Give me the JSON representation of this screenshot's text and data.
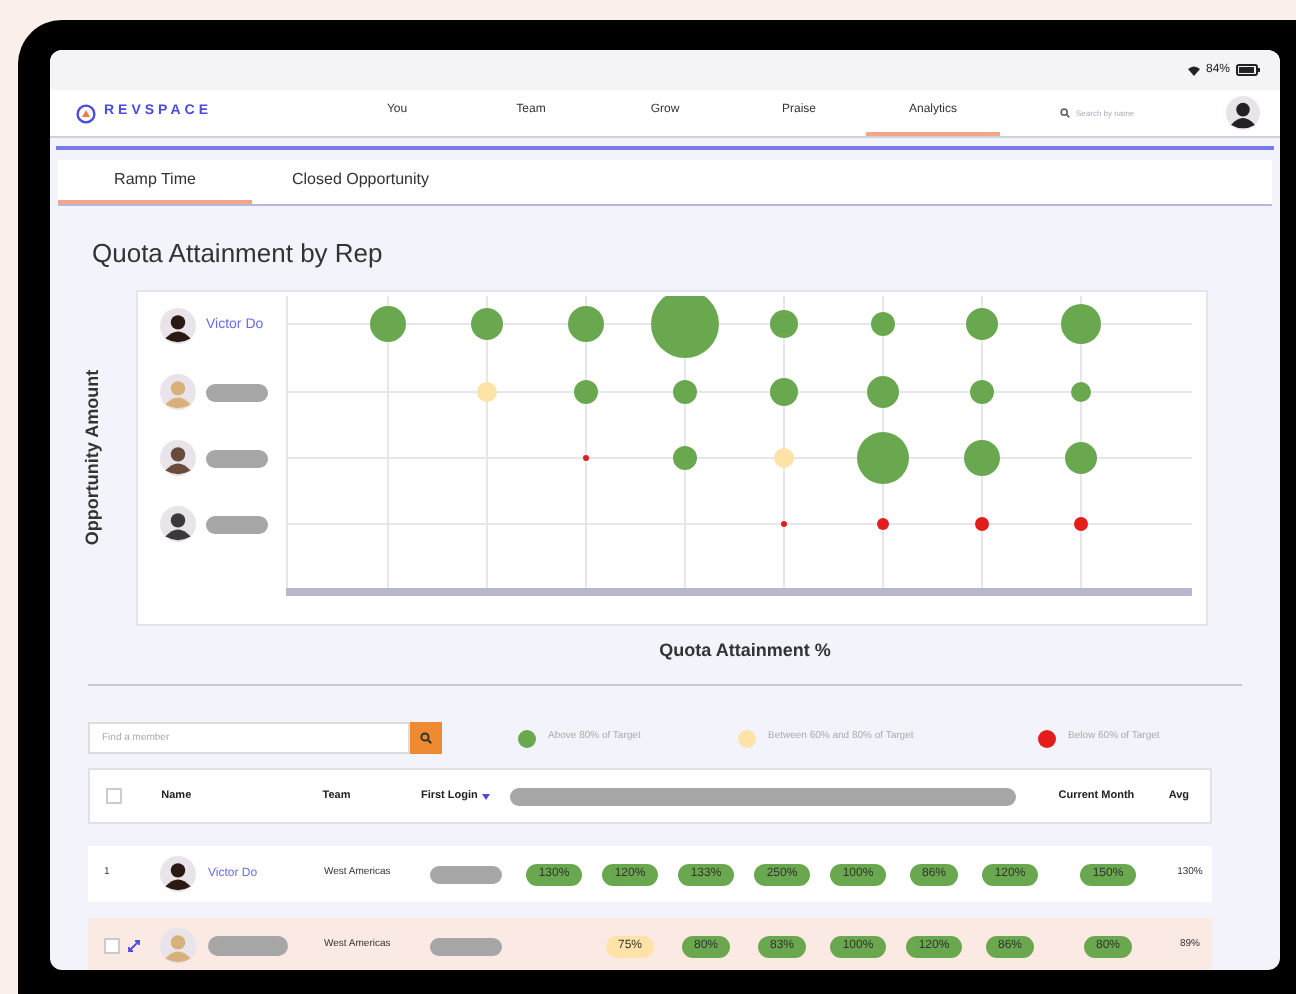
{
  "status_bar": {
    "battery": "84%"
  },
  "nav": {
    "logo": "REVSPACE",
    "items": [
      {
        "label": "You",
        "selected": false
      },
      {
        "label": "Team",
        "selected": false
      },
      {
        "label": "Grow",
        "selected": false
      },
      {
        "label": "Praise",
        "selected": false
      },
      {
        "label": "Analytics",
        "selected": true
      }
    ],
    "search": {
      "placeholder": "Search by name"
    }
  },
  "tabs": [
    {
      "label": "Ramp Time",
      "selected": true
    },
    {
      "label": "Closed Opportunity",
      "selected": false
    }
  ],
  "chart": {
    "title": "Quota Attainment by Rep",
    "ylabel": "Opportunity Amount",
    "xlabel": "Quota Attainment %",
    "reps": [
      {
        "kind": "named",
        "name": "Victor Do"
      },
      {
        "kind": "redacted"
      },
      {
        "kind": "redacted"
      },
      {
        "kind": "redacted"
      }
    ]
  },
  "member_search": {
    "placeholder": "Find a member"
  },
  "legend": [
    {
      "label": "Above 80% of Target",
      "color": "#6aa84f"
    },
    {
      "label": "Between 60% and 80% of Target",
      "color": "#fde3a7"
    },
    {
      "label": "Below 60% of Target",
      "color": "#e51c1c"
    }
  ],
  "table": {
    "header_checkbox": {
      "checked": false
    },
    "columns": [
      {
        "label": "Name",
        "sorted": false
      },
      {
        "label": "Team",
        "sorted": false
      },
      {
        "label": "First Login",
        "sorted": true
      },
      {
        "label": "Current Month",
        "sorted": false
      },
      {
        "label": "Avg",
        "sorted": false
      }
    ],
    "rows": [
      {
        "kind": "indexed",
        "index": "1",
        "name": "Victor Do",
        "team": "West Americas",
        "highlighted": false,
        "months": [
          {
            "value": "130%",
            "color": "#6aa84f"
          },
          {
            "value": "120%",
            "color": "#6aa84f"
          },
          {
            "value": "133%",
            "color": "#6aa84f"
          },
          {
            "value": "250%",
            "color": "#6aa84f"
          },
          {
            "value": "100%",
            "color": "#6aa84f"
          },
          {
            "value": "86%",
            "color": "#6aa84f"
          },
          {
            "value": "120%",
            "color": "#6aa84f"
          }
        ],
        "current_month": {
          "value": "150%",
          "color": "#6aa84f"
        },
        "avg": "130%"
      },
      {
        "kind": "selectable",
        "checked": false,
        "team": "West Americas",
        "highlighted": true,
        "months": [
          {
            "value": "75%",
            "color": "#fde3a7"
          },
          {
            "value": "80%",
            "color": "#6aa84f"
          },
          {
            "value": "83%",
            "color": "#6aa84f"
          },
          {
            "value": "100%",
            "color": "#6aa84f"
          },
          {
            "value": "120%",
            "color": "#6aa84f"
          },
          {
            "value": "86%",
            "color": "#6aa84f"
          }
        ],
        "current_month": {
          "value": "80%",
          "color": "#6aa84f"
        },
        "avg": "89%"
      }
    ]
  }
}
